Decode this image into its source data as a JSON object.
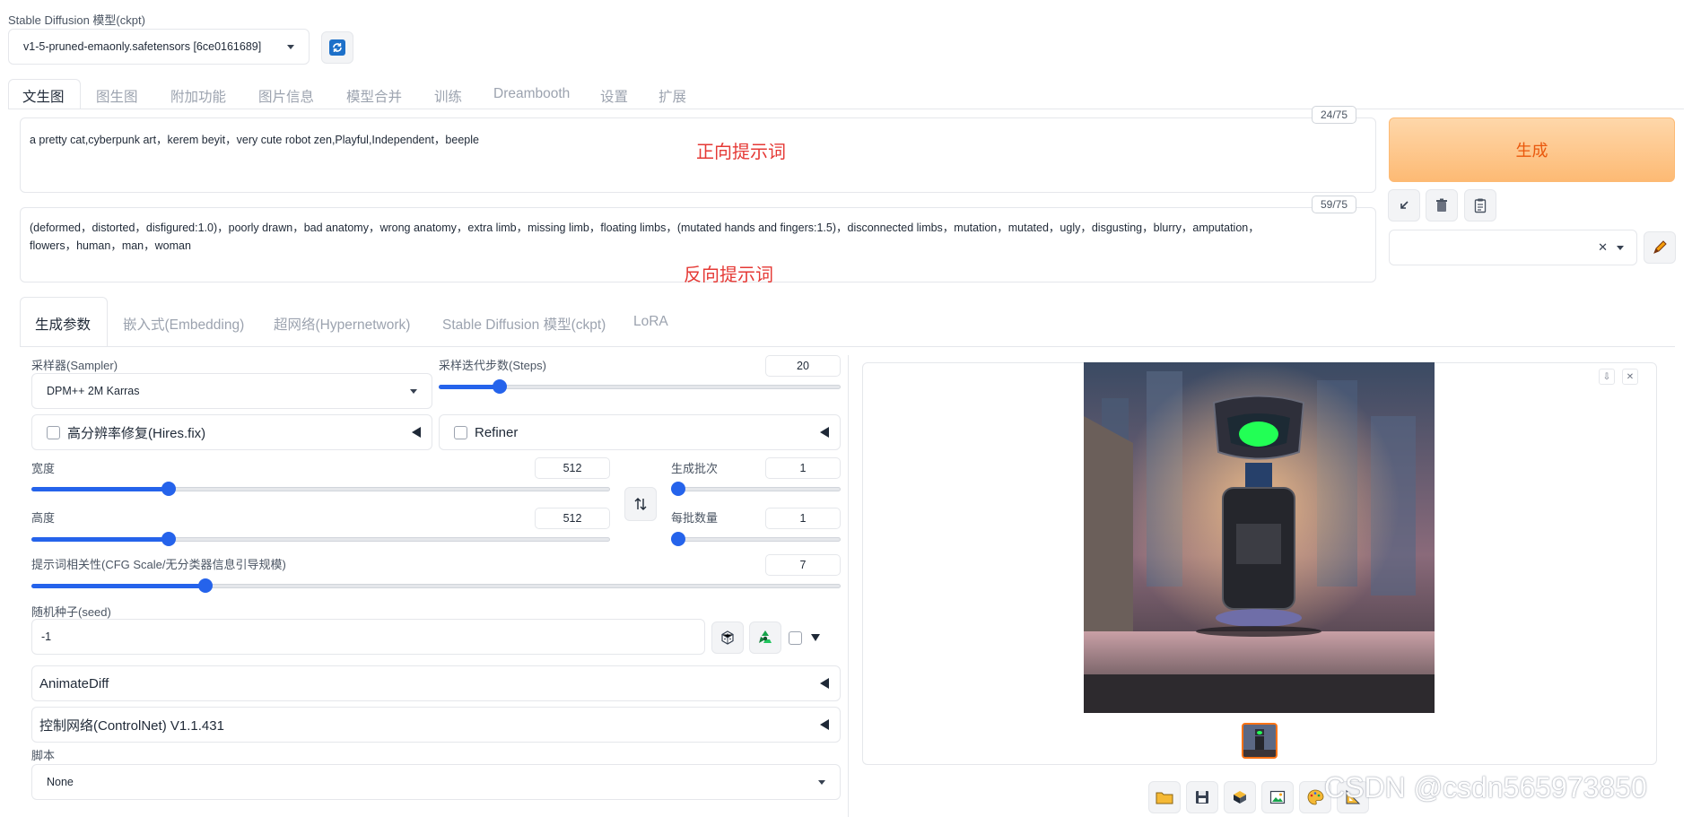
{
  "model": {
    "label": "Stable Diffusion 模型(ckpt)",
    "selected": "v1-5-pruned-emaonly.safetensors [6ce0161689]"
  },
  "main_tabs": [
    "文生图",
    "图生图",
    "附加功能",
    "图片信息",
    "模型合并",
    "训练",
    "Dreambooth",
    "设置",
    "扩展"
  ],
  "prompt": {
    "text": "a pretty cat,cyberpunk art，kerem beyit，very cute  robot zen,Playful,Independent，beeple",
    "counter": "24/75",
    "annotation": "正向提示词"
  },
  "negative_prompt": {
    "text": "(deformed，distorted，disfigured:1.0)，poorly drawn，bad anatomy，wrong anatomy，extra limb，missing limb，floating limbs，(mutated hands  and fingers:1.5)，disconnected limbs，mutation，mutated，ugly，disgusting，blurry，amputation，flowers，human，man，woman",
    "counter": "59/75",
    "annotation": "反向提示词"
  },
  "generate_label": "生成",
  "sub_tabs": [
    "生成参数",
    "嵌入式(Embedding)",
    "超网络(Hypernetwork)",
    "Stable Diffusion 模型(ckpt)",
    "LoRA"
  ],
  "sampler": {
    "label": "采样器(Sampler)",
    "value": "DPM++ 2M Karras"
  },
  "steps": {
    "label": "采样迭代步数(Steps)",
    "value": "20",
    "fraction": 0.14
  },
  "hires": {
    "label": "高分辨率修复(Hires.fix)"
  },
  "refiner": {
    "label": "Refiner"
  },
  "width": {
    "label": "宽度",
    "value": "512",
    "fraction": 0.23
  },
  "height": {
    "label": "高度",
    "value": "512",
    "fraction": 0.23
  },
  "batch_count": {
    "label": "生成批次",
    "value": "1",
    "fraction": 0.0
  },
  "batch_size": {
    "label": "每批数量",
    "value": "1",
    "fraction": 0.0
  },
  "cfg": {
    "label": "提示词相关性(CFG Scale/无分类器信息引导规模)",
    "value": "7",
    "fraction": 0.21
  },
  "seed": {
    "label": "随机种子(seed)",
    "value": "-1"
  },
  "animatediff": {
    "label": "AnimateDiff"
  },
  "controlnet": {
    "label": "控制网络(ControlNet) V1.1.431"
  },
  "script": {
    "label": "脚本",
    "value": "None"
  },
  "watermark": "CSDN @csdn565973850",
  "colors": {
    "accent": "#2563eb",
    "generate_bg": "#fdba74",
    "generate_text": "#ea580c",
    "annotation": "#e53935"
  }
}
